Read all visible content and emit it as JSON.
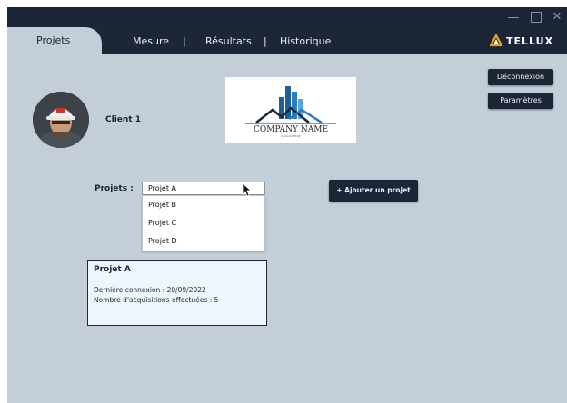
{
  "window": {
    "controls": [
      "minimize-icon",
      "maximize-icon",
      "close-icon"
    ]
  },
  "nav": {
    "active_tab": "Projets",
    "links": [
      "Mesure",
      "Résultats",
      "Historique"
    ],
    "separator": "|",
    "brand": "TELLUX"
  },
  "header_buttons": {
    "logout": "Déconnexion",
    "settings": "Paramètres"
  },
  "client": {
    "name": "Client 1",
    "avatar": "worker-with-helmet-photo"
  },
  "company_logo": {
    "text": "COMPANY NAME",
    "tagline": "SLOGAN HERE"
  },
  "project_selector": {
    "label": "Projets :",
    "selected": "Projet A",
    "options": [
      "Projet B",
      "Projet C",
      "Projet D"
    ]
  },
  "add_project_button": "+ Ajouter un projet",
  "project_card": {
    "title": "Projet A",
    "last_connection": "Dernière connexion : 20/09/2022",
    "acquisitions": "Nombre d'acquisitions effectuées : 5"
  },
  "colors": {
    "navy": "#1c2636",
    "background": "#c3ced8",
    "card": "#eff5fc",
    "logo_accent": "#e7a21e"
  }
}
